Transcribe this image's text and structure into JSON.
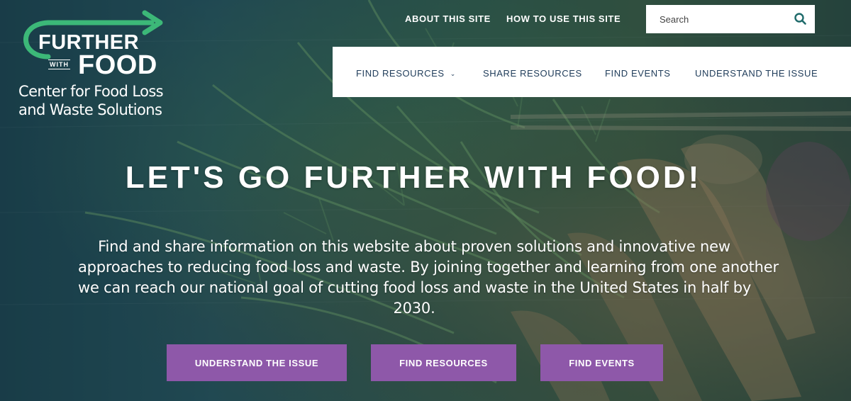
{
  "logo": {
    "word1": "FURTHER",
    "word2": "WITH",
    "word3": "FOOD",
    "subtitle_line1": "Center for Food Loss",
    "subtitle_line2": "and Waste Solutions",
    "arrow_color": "#3cb878"
  },
  "utility_nav": {
    "about": "ABOUT THIS SITE",
    "how_to": "HOW TO USE THIS SITE"
  },
  "search": {
    "placeholder": "Search",
    "icon": "search-icon",
    "icon_color": "#1f6b6b"
  },
  "main_nav": {
    "items": [
      {
        "label": "FIND RESOURCES",
        "has_dropdown": true,
        "icon": "chevron-down-icon"
      },
      {
        "label": "SHARE RESOURCES"
      },
      {
        "label": "FIND EVENTS"
      },
      {
        "label": "UNDERSTAND THE ISSUE"
      }
    ],
    "text_color": "#1f3c5a"
  },
  "hero": {
    "headline": "LET'S GO FURTHER WITH FOOD!",
    "intro_lines": [
      "Find and share information on this website about proven solutions and innovative new",
      "approaches to reducing food loss and waste. By joining together and learning from one another",
      "we can reach our national goal of cutting food loss and waste in the United States in half by",
      "2030."
    ]
  },
  "cta_buttons": {
    "understand": "UNDERSTAND THE ISSUE",
    "resources": "FIND RESOURCES",
    "events": "FIND EVENTS",
    "color": "#8e58a9"
  }
}
